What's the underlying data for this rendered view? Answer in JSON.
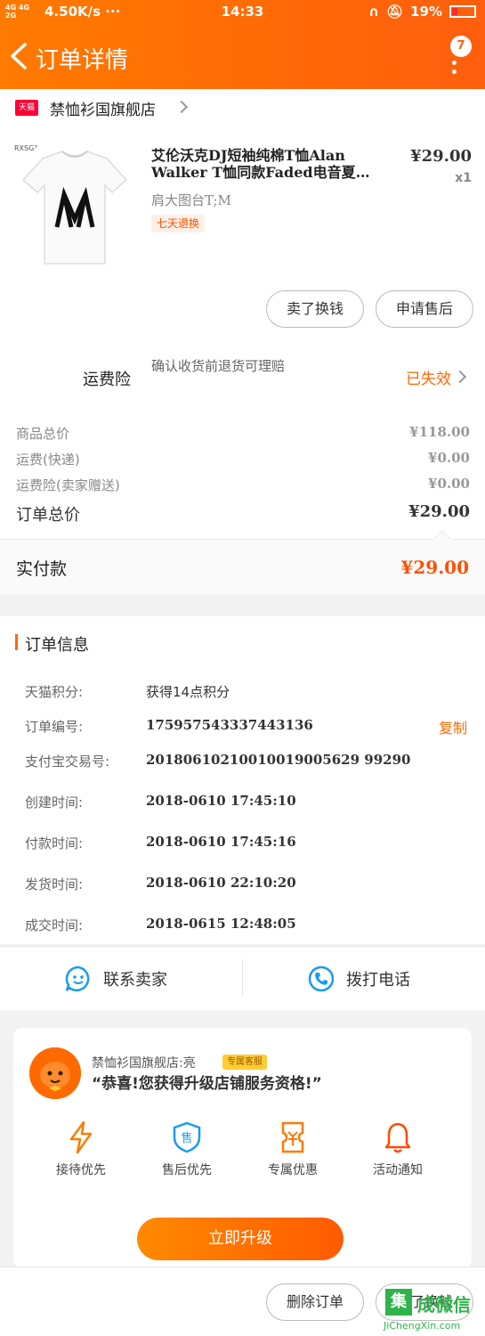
{
  "status_bar": {
    "network": "4G 4G 2G",
    "speed": "4.50K/s ···",
    "time": "14:33",
    "battery": "19%"
  },
  "nav": {
    "title": "订单详情",
    "badge_count": "7"
  },
  "shop": {
    "platform_tag": "天猫",
    "name": "禁恤衫国旗舰店"
  },
  "product": {
    "brand_mark": "RXSG°",
    "title": "艾伦沃克DJ短袖纯棉T恤Alan Walker T恤同款Faded电音夏…",
    "sku": "肩大图台T;M",
    "tag": "七天退换",
    "price": "¥29.00",
    "qty": "x1",
    "btn_sold_exchange": "卖了换钱",
    "btn_after_sale": "申请售后"
  },
  "insurance": {
    "label": "运费险",
    "desc": "确认收货前退货可理赔",
    "status": "已失效"
  },
  "totals": {
    "goods_total_label": "商品总价",
    "goods_total": "¥118.00",
    "shipping_label": "运费(快递)",
    "shipping": "¥0.00",
    "insurance_fee_label": "运费险(卖家赠送)",
    "insurance_fee": "¥0.00",
    "order_total_label": "订单总价",
    "order_total": "¥29.00",
    "paid_label": "实付款",
    "paid": "¥29.00"
  },
  "order_info": {
    "title": "订单信息",
    "rows": [
      {
        "key": "天猫积分:",
        "value": "获得14点积分"
      },
      {
        "key": "订单编号:",
        "value": "175957543337443136"
      },
      {
        "key": "支付宝交易号:",
        "value": "20180610210010019005629 99290"
      },
      {
        "key": "创建时间:",
        "value": "2018-0610 17:45:10"
      },
      {
        "key": "付款时间:",
        "value": "2018-0610 17:45:16"
      },
      {
        "key": "发货时间:",
        "value": "2018-0610 22:10:20"
      },
      {
        "key": "成交时间:",
        "value": "2018-0615 12:48:05"
      }
    ],
    "copy_label": "复制"
  },
  "contact": {
    "seller": "联系卖家",
    "call": "拨打电话"
  },
  "promo": {
    "shop_line": "禁恤衫国旗舰店:亮",
    "badge": "专属客服",
    "message": "“恭喜!您获得升级店铺服务资格!”",
    "features": [
      "接待优先",
      "售后优先",
      "专属优惠",
      "活动通知"
    ],
    "upgrade_btn": "立即升级"
  },
  "bottom": {
    "delete_btn": "删除订单",
    "sell_btn": "卖了换钱"
  },
  "watermark": {
    "logo_char": "集",
    "text": "成微信",
    "url": "JiChengXin.com"
  },
  "colors": {
    "accent": "#ff6a00",
    "price_red": "#ff5000",
    "tmall_red": "#ff0036"
  }
}
